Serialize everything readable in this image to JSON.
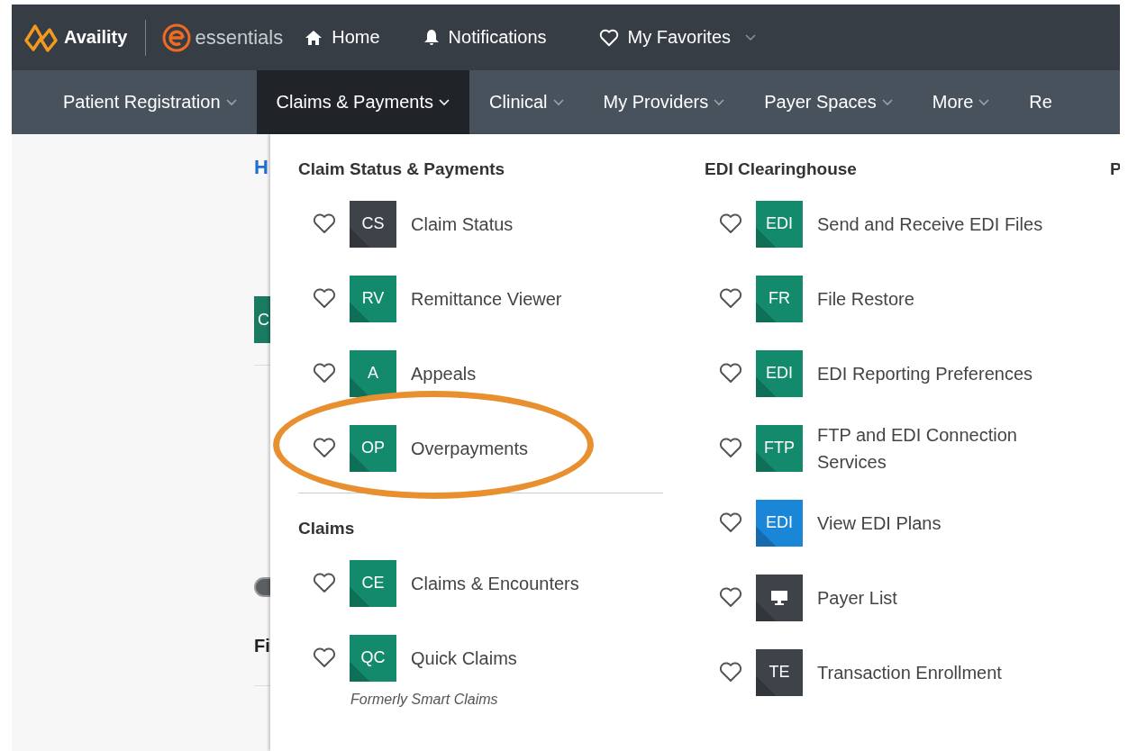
{
  "top_bar": {
    "brand": "Availity",
    "product": "essentials",
    "links": [
      {
        "kind": "home",
        "label": "Home",
        "caret": false
      },
      {
        "kind": "bell",
        "label": "Notifications",
        "caret": false
      },
      {
        "kind": "heart",
        "label": "My Favorites",
        "caret": true
      }
    ]
  },
  "nav": [
    {
      "label": "Patient Registration",
      "selected": false
    },
    {
      "label": "Claims & Payments",
      "selected": true
    },
    {
      "label": "Clinical",
      "selected": false
    },
    {
      "label": "My Providers",
      "selected": false
    },
    {
      "label": "Payer Spaces",
      "selected": false
    },
    {
      "label": "More",
      "selected": false
    },
    {
      "label": "Re",
      "selected": false
    }
  ],
  "page": {
    "link": "H",
    "button": "C",
    "heading": "Fi"
  },
  "menu": {
    "columns": [
      {
        "sections": [
          {
            "title": "Claim Status & Payments",
            "items": [
              {
                "tile": {
                  "kind": "letters",
                  "text": "CS",
                  "color": "#3e4249"
                },
                "label": "Claim Status",
                "highlighted": false
              },
              {
                "tile": {
                  "kind": "letters",
                  "text": "RV",
                  "color": "#138a6c"
                },
                "label": "Remittance Viewer",
                "highlighted": false
              },
              {
                "tile": {
                  "kind": "letters",
                  "text": "A",
                  "color": "#138a6c"
                },
                "label": "Appeals",
                "highlighted": false
              },
              {
                "tile": {
                  "kind": "letters",
                  "text": "OP",
                  "color": "#138a6c"
                },
                "label": "Overpayments",
                "highlighted": true
              }
            ]
          },
          {
            "title": "Claims",
            "items": [
              {
                "tile": {
                  "kind": "letters",
                  "text": "CE",
                  "color": "#138a6c"
                },
                "label": "Claims & Encounters",
                "highlighted": false
              },
              {
                "tile": {
                  "kind": "letters",
                  "text": "QC",
                  "color": "#138a6c"
                },
                "label": "Quick Claims",
                "note": "Formerly Smart Claims",
                "highlighted": false
              }
            ]
          }
        ]
      },
      {
        "sections": [
          {
            "title": "EDI Clearinghouse",
            "items": [
              {
                "tile": {
                  "kind": "letters",
                  "text": "EDI",
                  "color": "#138a6c"
                },
                "label": "Send and Receive EDI Files",
                "highlighted": false
              },
              {
                "tile": {
                  "kind": "letters",
                  "text": "FR",
                  "color": "#138a6c"
                },
                "label": "File Restore",
                "highlighted": false
              },
              {
                "tile": {
                  "kind": "letters",
                  "text": "EDI",
                  "color": "#138a6c"
                },
                "label": "EDI Reporting Preferences",
                "highlighted": false
              },
              {
                "tile": {
                  "kind": "letters",
                  "text": "FTP",
                  "color": "#138a6c"
                },
                "label": "FTP and EDI Connection Services",
                "highlighted": false
              },
              {
                "tile": {
                  "kind": "letters",
                  "text": "EDI",
                  "color": "#1a86d8"
                },
                "label": "View EDI Plans",
                "highlighted": false
              },
              {
                "tile": {
                  "kind": "monitor",
                  "color": "#3e4249"
                },
                "label": "Payer List",
                "highlighted": false
              },
              {
                "tile": {
                  "kind": "letters",
                  "text": "TE",
                  "color": "#3e4249"
                },
                "label": "Transaction Enrollment",
                "highlighted": false
              }
            ]
          }
        ]
      },
      {
        "sections": [
          {
            "title": "P"
          }
        ]
      }
    ]
  }
}
